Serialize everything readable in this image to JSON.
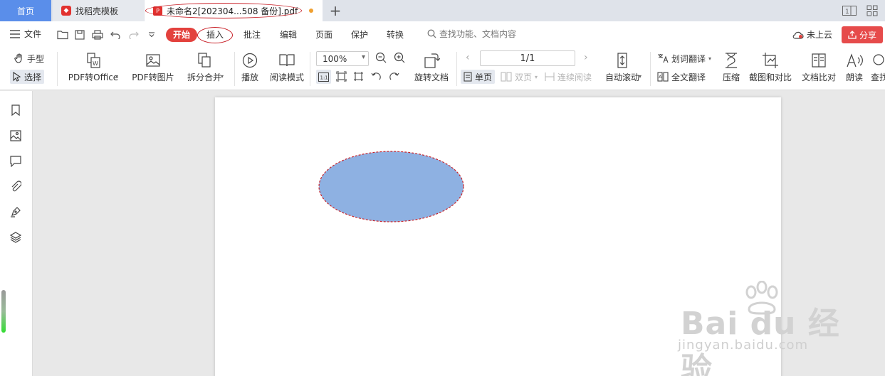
{
  "tabs": {
    "home": "首页",
    "template": "找稻壳模板",
    "pdf": "未命名2[202304...508 备份].pdf",
    "add": "+"
  },
  "menu": {
    "file": "文件",
    "tabs": [
      "开始",
      "插入",
      "批注",
      "编辑",
      "页面",
      "保护",
      "转换"
    ],
    "search_placeholder": "查找功能、文档内容",
    "cloud": "未上云",
    "share": "分享"
  },
  "toolbar": {
    "hand": "手型",
    "select": "选择",
    "pdf_to_office": "PDF转Office",
    "pdf_to_image": "PDF转图片",
    "split_merge": "拆分合并",
    "play": "播放",
    "read_mode": "阅读模式",
    "zoom": "100%",
    "rotate_doc": "旋转文档",
    "page_indicator": "1/1",
    "single_page": "单页",
    "double_page": "双页",
    "continuous": "连续阅读",
    "auto_scroll": "自动滚动",
    "word_translate": "划词翻译",
    "full_translate": "全文翻译",
    "compress": "压缩",
    "screenshot_compare": "截图和对比",
    "doc_compare": "文档比对",
    "read_aloud": "朗读",
    "find": "查找"
  },
  "watermark": {
    "main": "Bai du 经验",
    "sub": "jingyan.baidu.com"
  },
  "colors": {
    "accent_red": "#e3413d",
    "home_tab_blue": "#5a8eea",
    "ellipse_fill": "#8eb1e2",
    "ellipse_stroke": "#c9242b"
  }
}
